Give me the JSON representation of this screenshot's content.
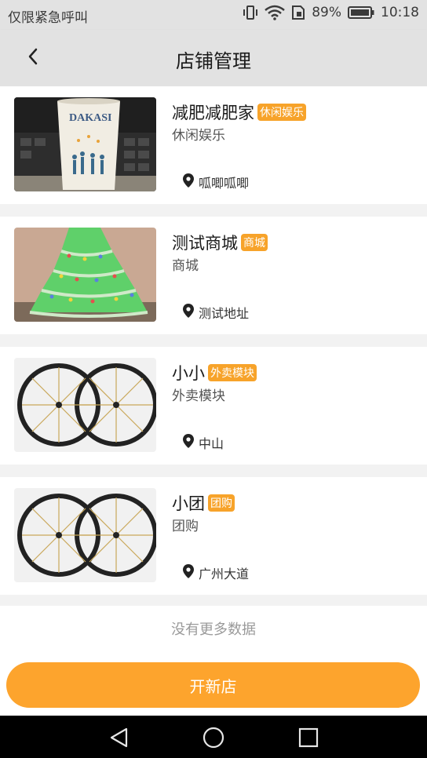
{
  "status_bar": {
    "carrier": "仅限紧急呼叫",
    "battery": "89%",
    "time": "10:18"
  },
  "header": {
    "title": "店铺管理"
  },
  "stores": [
    {
      "name": "减肥减肥家",
      "badge": "休闲娱乐",
      "category": "休闲娱乐",
      "address": "呱唧呱唧",
      "image": "paper-cup-photo"
    },
    {
      "name": "测试商城",
      "badge": "商城",
      "category": "商城",
      "address": "测试地址",
      "image": "green-cake-photo"
    },
    {
      "name": "小小",
      "badge": "外卖模块",
      "category": "外卖模块",
      "address": "中山",
      "image": "bicycle-wheels-photo"
    },
    {
      "name": "小团",
      "badge": "团购",
      "category": "团购",
      "address": "广州大道",
      "image": "bicycle-wheels-photo"
    }
  ],
  "no_more_text": "没有更多数据",
  "footer": {
    "open_store_label": "开新店"
  },
  "colors": {
    "accent": "#fda42d",
    "badge": "#f7a32a"
  }
}
